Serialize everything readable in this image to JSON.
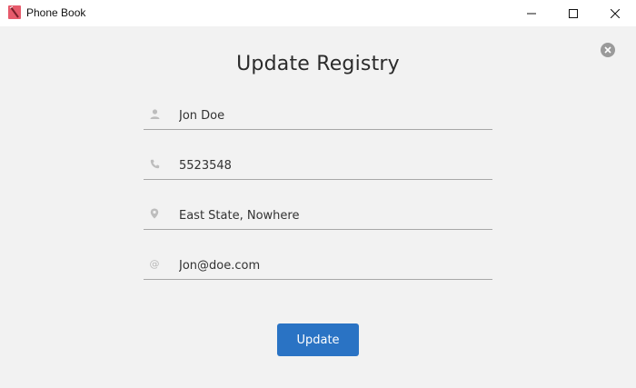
{
  "window": {
    "title": "Phone Book",
    "controls": [
      "minimize",
      "maximize",
      "close"
    ]
  },
  "dialog": {
    "title": "Update Registry",
    "close_icon": "close-circle-icon"
  },
  "form": {
    "fields": [
      {
        "icon": "person-icon",
        "value": "Jon Doe"
      },
      {
        "icon": "phone-icon",
        "value": "5523548"
      },
      {
        "icon": "location-pin-icon",
        "value": "East State, Nowhere"
      },
      {
        "icon": "at-icon",
        "symbol": "@",
        "value": "Jon@doe.com"
      }
    ],
    "submit_label": "Update"
  },
  "colors": {
    "accent": "#2a73c4",
    "background": "#f2f2f2",
    "icon": "#b9b9b9",
    "app_icon": "#e65a6b"
  }
}
